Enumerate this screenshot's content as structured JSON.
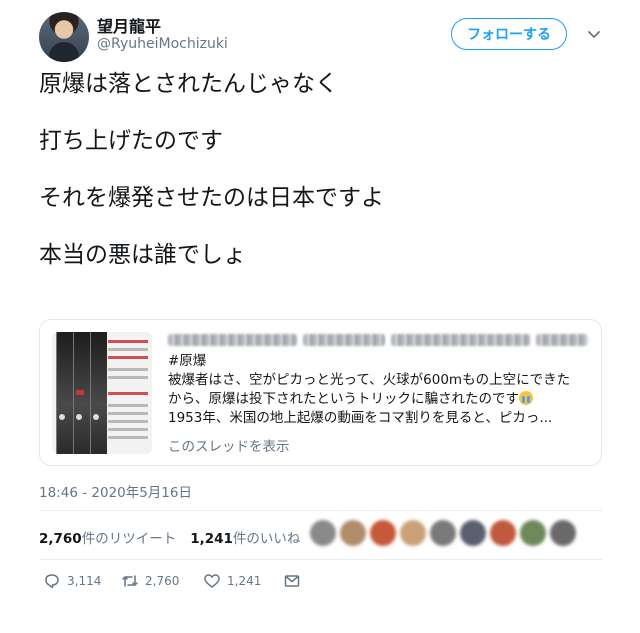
{
  "author": {
    "display_name": "望月龍平",
    "handle": "@RyuheiMochizuki"
  },
  "follow_label": "フォローする",
  "tweet_lines": [
    "原爆は落とされたんじゃなく",
    "打ち上げたのです",
    "それを爆発させたのは日本ですよ",
    "本当の悪は誰でしょ"
  ],
  "quote": {
    "lines": [
      "#原爆",
      "被爆者はさ、空がピカっと光って、火球が600mもの上空にできた",
      "から、原爆は投下されたというトリックに騙されたのです",
      "1953年、米国の地上起爆の動画をコマ割りを見ると、ピカっ..."
    ],
    "show_thread": "このスレッドを表示"
  },
  "timestamp": "18:46 - 2020年5月16日",
  "stats": {
    "retweets_count": "2,760",
    "retweets_label": "件のリツイート",
    "likes_count": "1,241",
    "likes_label": "件のいいね"
  },
  "actions": {
    "replies": "3,114",
    "retweets": "2,760",
    "likes": "1,241"
  },
  "icons": [
    "caret-down-icon",
    "reply-icon",
    "retweet-icon",
    "like-icon",
    "message-icon",
    "crying-emoji-icon"
  ],
  "colors": {
    "accent": "#1da1f2",
    "text": "#14171a",
    "secondary": "#657786",
    "border": "#e1e8ed"
  }
}
